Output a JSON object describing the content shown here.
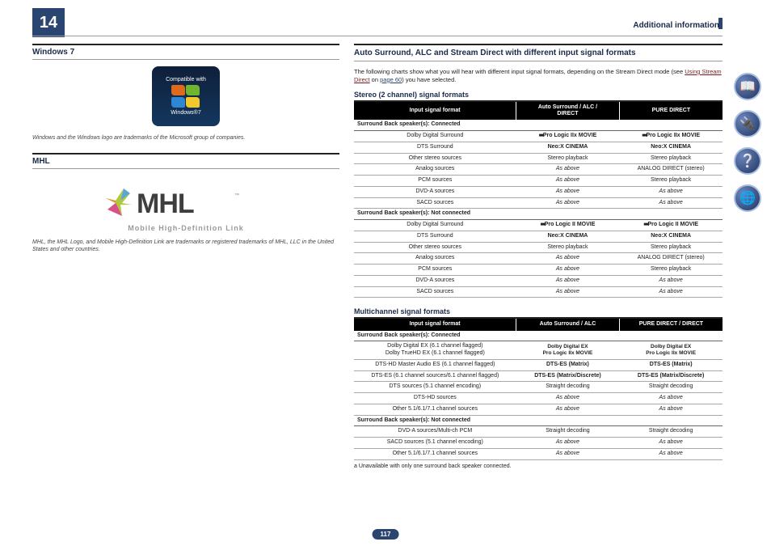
{
  "chapter_number": "14",
  "top_right": "Additional information",
  "page_number": "117",
  "left": {
    "win_heading": "Windows 7",
    "win_compat_top": "Compatible with",
    "win_compat_bottom": "Windows®7",
    "win_note": "Windows and the Windows logo are trademarks of the Microsoft group of companies.",
    "mhl_heading": "MHL",
    "mhl_brand": "MHL",
    "mhl_sub": "Mobile High-Definition Link",
    "mhl_note": "MHL, the MHL Logo, and Mobile High-Definition Link are trademarks or registered trademarks of MHL, LLC in the United States and other countries."
  },
  "right": {
    "main_heading": "Auto Surround, ALC and Stream Direct with different input signal formats",
    "intro_a": "The following charts show what you will hear with different input signal formats, depending on the Stream Direct mode (see ",
    "intro_link": "Using Stream Direct",
    "intro_on": " on ",
    "intro_page": "page 60",
    "intro_b": ") you have selected.",
    "stereo_heading": "Stereo (2 channel) signal formats",
    "stereo_headers": [
      "Input signal format",
      "Auto Surround / ALC / DIRECT",
      "PURE DIRECT"
    ],
    "stereo_rows": [
      {
        "type": "group",
        "c1": "Surround Back speaker(s): Connected"
      },
      {
        "type": "row",
        "c1": "Dolby Digital Surround",
        "c2": "Pro Logic IIx MOVIE",
        "c2cls": "dd b",
        "c3": "Pro Logic IIx MOVIE",
        "c3cls": "dd b"
      },
      {
        "type": "row",
        "c1": "DTS Surround",
        "c2": "Neo:X CINEMA",
        "c2cls": "b",
        "c3": "Neo:X CINEMA",
        "c3cls": "b"
      },
      {
        "type": "row",
        "c1": "Other stereo sources",
        "c2": "Stereo playback",
        "c3": "Stereo playback"
      },
      {
        "type": "row",
        "c1": "Analog sources",
        "c2": "As above",
        "c2cls": "italic",
        "c3": "ANALOG DIRECT (stereo)"
      },
      {
        "type": "row",
        "c1": "PCM sources",
        "c2": "As above",
        "c2cls": "italic",
        "c3": "Stereo playback"
      },
      {
        "type": "row",
        "c1": "DVD-A sources",
        "c2": "As above",
        "c2cls": "italic",
        "c3": "As above",
        "c3cls": "italic"
      },
      {
        "type": "row",
        "c1": "SACD sources",
        "c2": "As above",
        "c2cls": "italic",
        "c3": "As above",
        "c3cls": "italic"
      },
      {
        "type": "group",
        "c1": "Surround Back speaker(s): Not connected"
      },
      {
        "type": "row",
        "c1": "Dolby Digital Surround",
        "c2": "Pro Logic II MOVIE",
        "c2cls": "dd b",
        "c3": "Pro Logic II MOVIE",
        "c3cls": "dd b"
      },
      {
        "type": "row",
        "c1": "DTS Surround",
        "c2": "Neo:X CINEMA",
        "c2cls": "b",
        "c3": "Neo:X CINEMA",
        "c3cls": "b"
      },
      {
        "type": "row",
        "c1": "Other stereo sources",
        "c2": "Stereo playback",
        "c3": "Stereo playback"
      },
      {
        "type": "row",
        "c1": "Analog sources",
        "c2": "As above",
        "c2cls": "italic",
        "c3": "ANALOG DIRECT (stereo)"
      },
      {
        "type": "row",
        "c1": "PCM sources",
        "c2": "As above",
        "c2cls": "italic",
        "c3": "Stereo playback"
      },
      {
        "type": "row",
        "c1": "DVD-A sources",
        "c2": "As above",
        "c2cls": "italic",
        "c3": "As above",
        "c3cls": "italic"
      },
      {
        "type": "row",
        "c1": "SACD sources",
        "c2": "As above",
        "c2cls": "italic",
        "c3": "As above",
        "c3cls": "italic"
      }
    ],
    "multi_heading": "Multichannel signal formats",
    "multi_headers": [
      "Input signal format",
      "Auto Surround / ALC",
      "PURE DIRECT / DIRECT"
    ],
    "multi_rows": [
      {
        "type": "group",
        "c1": "Surround Back speaker(s): Connected"
      },
      {
        "type": "row",
        "c1": "Dolby Digital EX (6.1 channel flagged)\nDolby TrueHD EX (6.1 channel flagged)",
        "c2": "Dolby Digital EX\n Pro Logic IIx MOVIE\n<a>",
        "c2cls": "b smnote",
        "c3": "Dolby Digital EX\n Pro Logic IIx MOVIE\n<a>",
        "c3cls": "b smnote"
      },
      {
        "type": "row",
        "c1": "DTS-HD Master Audio ES (6.1 channel flagged)",
        "c2": "DTS-ES (Matrix)",
        "c2cls": "b",
        "c3": "DTS-ES (Matrix)",
        "c3cls": "b"
      },
      {
        "type": "row",
        "c1": "DTS-ES (6.1 channel sources/6.1 channel flagged)",
        "c2": "DTS-ES (Matrix/Discrete)",
        "c2cls": "b",
        "c3": "DTS-ES (Matrix/Discrete)",
        "c3cls": "b"
      },
      {
        "type": "row",
        "c1": "DTS sources (5.1 channel encoding)",
        "c2": "Straight decoding",
        "c3": "Straight decoding"
      },
      {
        "type": "row",
        "c1": "DTS-HD sources",
        "c2": "As above",
        "c2cls": "italic",
        "c3": "As above",
        "c3cls": "italic"
      },
      {
        "type": "row",
        "c1": "Other 5.1/6.1/7.1 channel sources",
        "c2": "As above",
        "c2cls": "italic",
        "c3": "As above",
        "c3cls": "italic"
      },
      {
        "type": "group",
        "c1": "Surround Back speaker(s): Not connected"
      },
      {
        "type": "row",
        "c1": "DVD-A sources/Multi-ch PCM",
        "c2": "Straight decoding",
        "c3": "Straight decoding"
      },
      {
        "type": "row",
        "c1": "SACD sources (5.1 channel encoding)",
        "c2": "As above",
        "c2cls": "italic",
        "c3": "As above",
        "c3cls": "italic"
      },
      {
        "type": "row",
        "c1": "Other 5.1/6.1/7.1 channel sources",
        "c2": "As above",
        "c2cls": "italic",
        "c3": "As above",
        "c3cls": "italic"
      }
    ],
    "footnote": "a   Unavailable with only one surround back speaker connected."
  },
  "sidebar": [
    {
      "name": "book-icon",
      "glyph": "📖"
    },
    {
      "name": "connect-icon",
      "glyph": "🔌"
    },
    {
      "name": "help-icon",
      "glyph": "❔"
    },
    {
      "name": "globe-icon",
      "glyph": "🌐"
    }
  ]
}
